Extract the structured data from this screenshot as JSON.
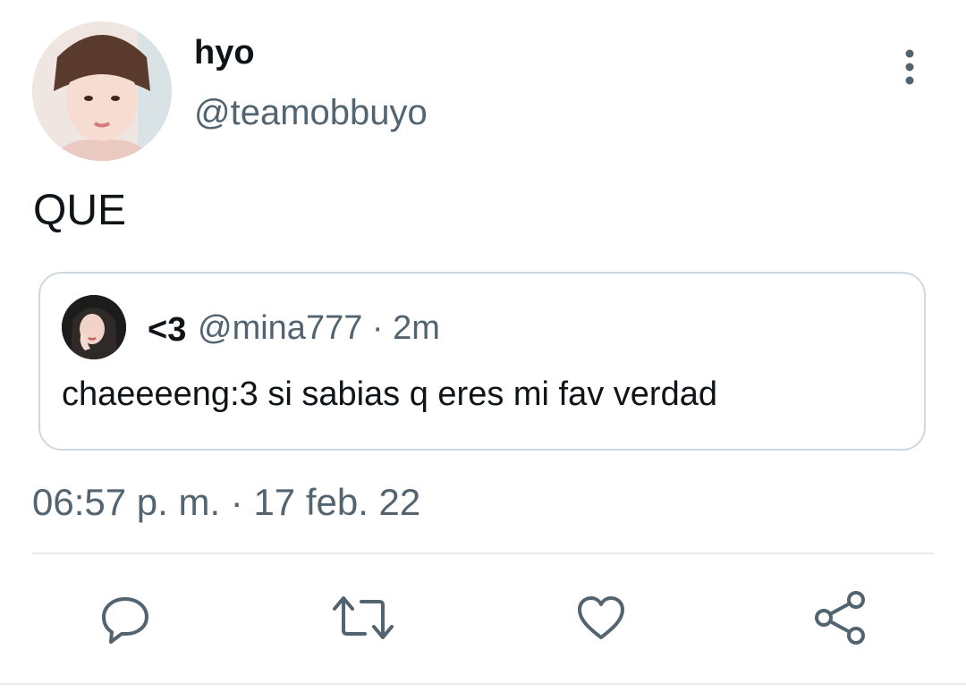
{
  "author": {
    "display_name": "hyo",
    "handle": "@teamobbuyo"
  },
  "tweet": {
    "text": "QUE",
    "timestamp": "06:57 p. m. · 17 feb. 22"
  },
  "quoted_tweet": {
    "display_name": "<3",
    "meta": "@mina777 · 2m",
    "text": "chaeeeeng:3 si sabias q eres mi fav verdad"
  },
  "actions": [
    {
      "icon": "reply-icon"
    },
    {
      "icon": "retweet-icon"
    },
    {
      "icon": "like-icon"
    },
    {
      "icon": "share-icon"
    }
  ],
  "colors": {
    "text": "#0f1419",
    "secondary": "#536471",
    "border": "#cfd9de"
  }
}
